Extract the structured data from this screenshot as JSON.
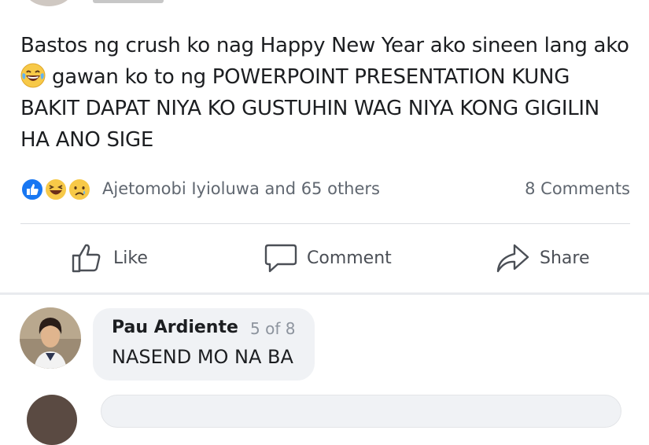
{
  "post": {
    "text_line1": "Bastos ng crush ko nag Happy New Year ako sineen lang ako",
    "text_line2": "gawan ko to ng POWERPOINT PRESENTATION KUNG BAKIT DAPAT NIYA KO GUSTUHIN WAG NIYA KONG GIGILIN HA ANO SIGE",
    "emoji": "laughing-tears-emoji"
  },
  "reactions": {
    "icons": [
      "like-icon",
      "haha-icon",
      "sad-icon"
    ],
    "reactors": "Ajetomobi Iyioluwa and 65 others",
    "comments_count": "8 Comments"
  },
  "actions": {
    "like": "Like",
    "comment": "Comment",
    "share": "Share"
  },
  "comment": {
    "author": "Pau Ardiente",
    "index": "5 of 8",
    "text": "NASEND MO NA BA"
  },
  "colors": {
    "facebook_blue": "#1877f2",
    "secondary_text": "#606770",
    "bubble_bg": "#f0f2f5",
    "reaction_yellow": "#f7c948"
  }
}
